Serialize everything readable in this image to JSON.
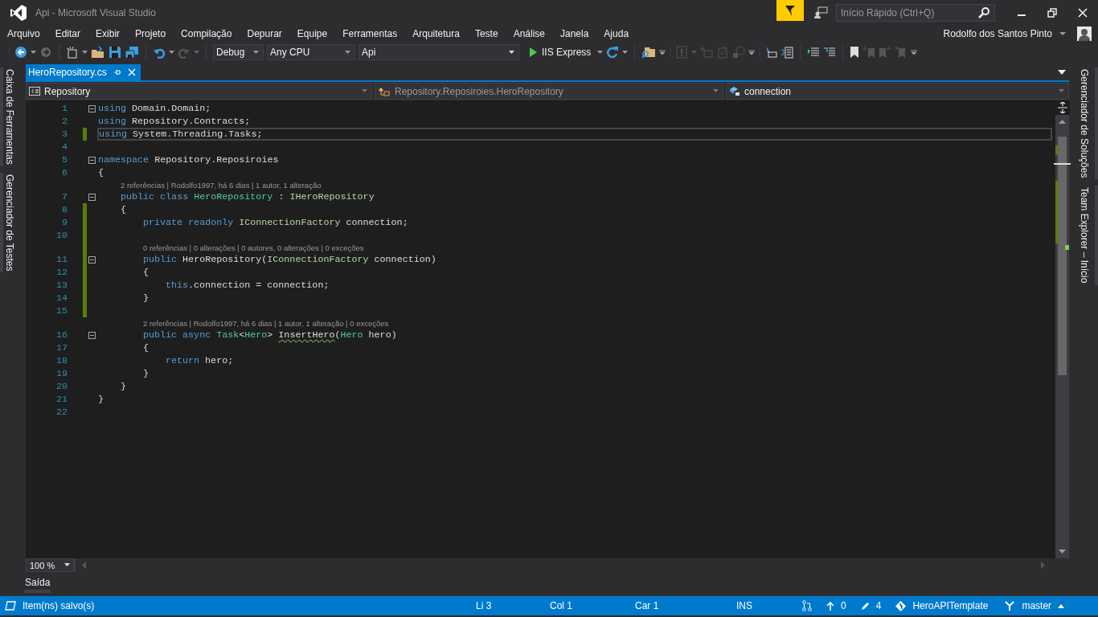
{
  "window": {
    "title": "Api - Microsoft Visual Studio"
  },
  "quick_launch": {
    "placeholder": "Início Rápido (Ctrl+Q)"
  },
  "menu": [
    "Arquivo",
    "Editar",
    "Exibir",
    "Projeto",
    "Compilação",
    "Depurar",
    "Equipe",
    "Ferramentas",
    "Arquitetura",
    "Teste",
    "Análise",
    "Janela",
    "Ajuda"
  ],
  "account": {
    "name": "Rodolfo dos Santos Pinto"
  },
  "toolbar": {
    "configuration": "Debug",
    "platform": "Any CPU",
    "startup_project": "Api",
    "run": "IIS Express"
  },
  "side_tabs_left": [
    "Caixa de Ferramentas",
    "Gerenciador de Testes"
  ],
  "side_tabs_right": [
    "Gerenciador de Soluções",
    "Team Explorer – Início"
  ],
  "document_tabs": [
    {
      "label": "HeroRepository.cs",
      "selected": true
    }
  ],
  "nav_bar": {
    "project": "Repository",
    "type": "Repository.Reposiroies.HeroRepository",
    "member": "connection"
  },
  "code_lines": [
    {
      "kind": "code",
      "number": "1",
      "collapsible": true,
      "changed": false,
      "current": false,
      "tokens": [
        {
          "kind": "keyword",
          "text": "using"
        },
        {
          "kind": "plain",
          "text": " Domain.Domain;"
        }
      ]
    },
    {
      "kind": "code",
      "number": "2",
      "collapsible": false,
      "changed": false,
      "current": false,
      "tokens": [
        {
          "kind": "keyword",
          "text": "using"
        },
        {
          "kind": "plain",
          "text": " Repository.Contracts;"
        }
      ]
    },
    {
      "kind": "code",
      "number": "3",
      "collapsible": false,
      "changed": true,
      "current": true,
      "tokens": [
        {
          "kind": "keyword",
          "text": "using"
        },
        {
          "kind": "plain",
          "text": " System.Threading.Tasks;"
        }
      ]
    },
    {
      "kind": "code",
      "number": "4",
      "collapsible": false,
      "changed": false,
      "current": false
    },
    {
      "kind": "code",
      "number": "5",
      "collapsible": true,
      "changed": false,
      "current": false,
      "tokens": [
        {
          "kind": "keyword",
          "text": "namespace"
        },
        {
          "kind": "plain",
          "text": " Repository.Reposiroies"
        }
      ]
    },
    {
      "kind": "code",
      "number": "6",
      "collapsible": false,
      "changed": false,
      "current": false,
      "tokens": [
        {
          "kind": "open-brace",
          "text": "{"
        }
      ]
    },
    {
      "kind": "lens",
      "changed": false,
      "text": "2 referências | Rodolfo1997, há 6 dias | 1 autor, 1 alteração"
    },
    {
      "kind": "code",
      "number": "7",
      "collapsible": true,
      "changed": false,
      "current": false,
      "tokens": [
        {
          "kind": "keyword",
          "text": "public class "
        },
        {
          "kind": "type",
          "text": "HeroRepository"
        },
        {
          "kind": "plain",
          "text": " : "
        },
        {
          "kind": "interface",
          "text": "IHeroRepository"
        }
      ]
    },
    {
      "kind": "code",
      "number": "8",
      "collapsible": false,
      "changed": true,
      "current": false,
      "tokens": [
        {
          "kind": "open-brace",
          "text": "{"
        }
      ]
    },
    {
      "kind": "code",
      "number": "9",
      "collapsible": false,
      "changed": true,
      "current": false,
      "tokens": [
        {
          "kind": "keyword",
          "text": "private readonly "
        },
        {
          "kind": "interface",
          "text": "IConnectionFactory"
        },
        {
          "kind": "plain",
          "text": " connection;"
        }
      ]
    },
    {
      "kind": "code",
      "number": "10",
      "collapsible": false,
      "changed": true,
      "current": false
    },
    {
      "kind": "lens",
      "changed": true,
      "text": "0 referências | 0 alterações | 0 autores, 0 alterações | 0 exceções"
    },
    {
      "kind": "code",
      "number": "11",
      "collapsible": true,
      "changed": true,
      "current": false,
      "tokens": [
        {
          "kind": "keyword",
          "text": "public"
        },
        {
          "kind": "plain",
          "text": " HeroRepository("
        },
        {
          "kind": "interface",
          "text": "IConnectionFactory"
        },
        {
          "kind": "plain",
          "text": " connection)"
        }
      ]
    },
    {
      "kind": "code",
      "number": "12",
      "collapsible": false,
      "changed": true,
      "current": false,
      "tokens": [
        {
          "kind": "open-brace",
          "text": "{"
        }
      ]
    },
    {
      "kind": "code",
      "number": "13",
      "collapsible": false,
      "changed": true,
      "current": false,
      "tokens": [
        {
          "kind": "keyword",
          "text": "this"
        },
        {
          "kind": "plain",
          "text": ".connection = connection;"
        }
      ]
    },
    {
      "kind": "code",
      "number": "14",
      "collapsible": false,
      "changed": true,
      "current": false,
      "tokens": [
        {
          "kind": "close-brace",
          "text": "}"
        }
      ]
    },
    {
      "kind": "code",
      "number": "15",
      "collapsible": false,
      "changed": true,
      "current": false
    },
    {
      "kind": "lens",
      "changed": false,
      "text": "2 referências | Rodolfo1997, há 6 dias | 1 autor, 1 alteração | 0 exceções"
    },
    {
      "kind": "code",
      "number": "16",
      "collapsible": true,
      "changed": false,
      "current": false,
      "tokens": [
        {
          "kind": "keyword",
          "text": "public async "
        },
        {
          "kind": "type",
          "text": "Task"
        },
        {
          "kind": "plain",
          "text": "<"
        },
        {
          "kind": "type",
          "text": "Hero"
        },
        {
          "kind": "plain",
          "text": "> "
        },
        {
          "kind": "squiggle",
          "text": "InsertHero"
        },
        {
          "kind": "plain",
          "text": "("
        },
        {
          "kind": "type",
          "text": "Hero"
        },
        {
          "kind": "plain",
          "text": " hero)"
        }
      ]
    },
    {
      "kind": "code",
      "number": "17",
      "collapsible": false,
      "changed": false,
      "current": false,
      "tokens": [
        {
          "kind": "open-brace",
          "text": "{"
        }
      ]
    },
    {
      "kind": "code",
      "number": "18",
      "collapsible": false,
      "changed": false,
      "current": false,
      "tokens": [
        {
          "kind": "keyword",
          "text": "return"
        },
        {
          "kind": "plain",
          "text": " hero;"
        }
      ]
    },
    {
      "kind": "code",
      "number": "19",
      "collapsible": false,
      "changed": false,
      "current": false,
      "tokens": [
        {
          "kind": "close-brace",
          "text": "}"
        }
      ]
    },
    {
      "kind": "code",
      "number": "20",
      "collapsible": false,
      "changed": false,
      "current": false,
      "tokens": [
        {
          "kind": "close-brace",
          "text": "}"
        }
      ]
    },
    {
      "kind": "code",
      "number": "21",
      "collapsible": false,
      "changed": false,
      "current": false,
      "tokens": [
        {
          "kind": "close-brace",
          "text": "}"
        }
      ]
    },
    {
      "kind": "code",
      "number": "22",
      "collapsible": false,
      "changed": false,
      "current": false
    }
  ],
  "zoom": "100 %",
  "output_tabs": [
    "Saída"
  ],
  "status_bar": {
    "message": "Item(ns) salvo(s)",
    "line": "Li 3",
    "column": "Col 1",
    "char": "Car 1",
    "mode": "INS",
    "unpushed": "0",
    "changes": "4",
    "repository": "HeroAPITemplate",
    "branch": "master"
  }
}
